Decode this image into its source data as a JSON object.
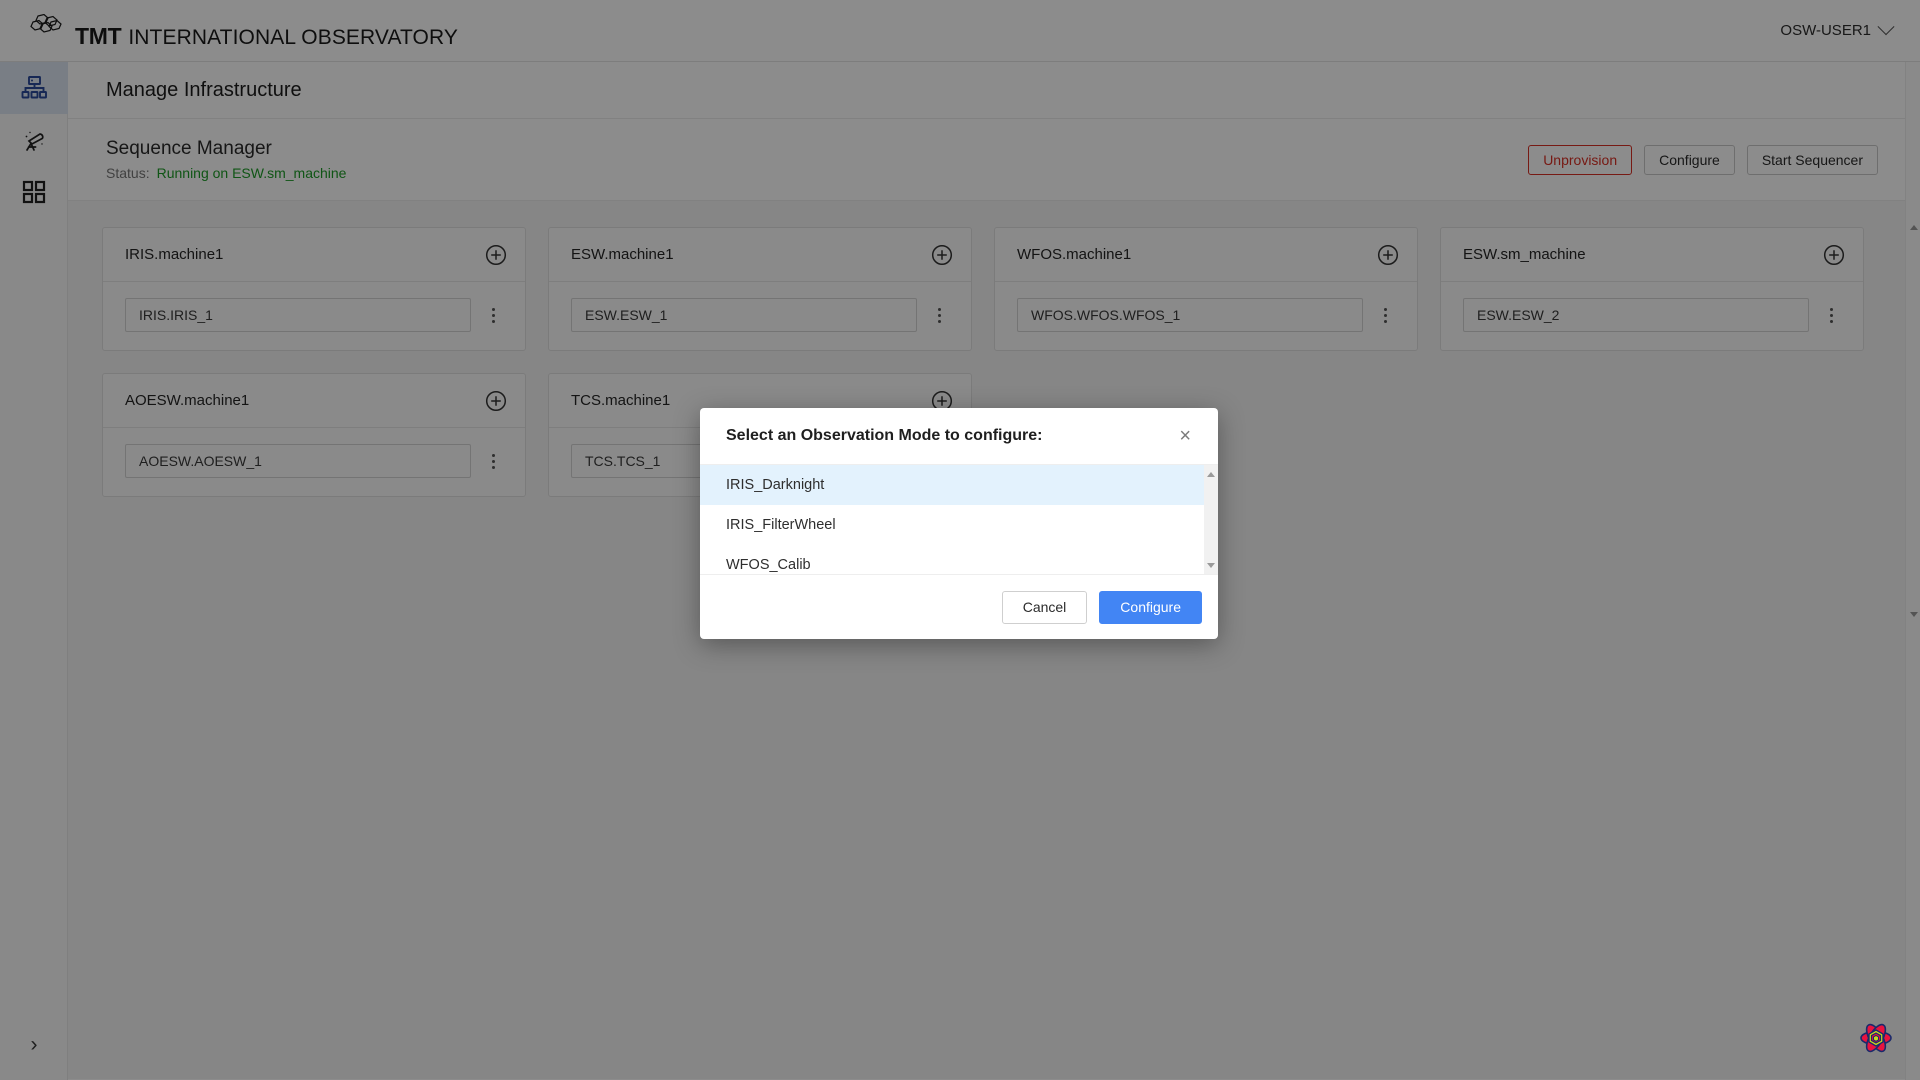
{
  "topbar": {
    "brand_tmt": "TMT",
    "brand_rest": "INTERNATIONAL OBSERVATORY",
    "user": "OSW-USER1"
  },
  "sidebar": {
    "items": [
      {
        "icon": "sitemap-icon",
        "name": "manage-infrastructure",
        "active": true
      },
      {
        "icon": "telescope-icon",
        "name": "observations",
        "active": false
      },
      {
        "icon": "grid-icon",
        "name": "resources",
        "active": false
      }
    ],
    "expand_label": "›"
  },
  "header": {
    "title": "Manage Infrastructure"
  },
  "sequence_manager": {
    "title": "Sequence Manager",
    "status_label": "Status:",
    "status_value": "Running on ESW.sm_machine",
    "status_color": "#1d9b27",
    "buttons": [
      {
        "label": "Unprovision",
        "style": "danger"
      },
      {
        "label": "Configure",
        "style": "default"
      },
      {
        "label": "Start Sequencer",
        "style": "default"
      }
    ]
  },
  "machines": [
    {
      "title": "IRIS.machine1",
      "sequencers": [
        "IRIS.IRIS_1"
      ]
    },
    {
      "title": "ESW.machine1",
      "sequencers": [
        "ESW.ESW_1"
      ]
    },
    {
      "title": "WFOS.machine1",
      "sequencers": [
        "WFOS.WFOS.WFOS_1"
      ]
    },
    {
      "title": "ESW.sm_machine",
      "sequencers": [
        "ESW.ESW_2"
      ]
    },
    {
      "title": "AOESW.machine1",
      "sequencers": [
        "AOESW.AOESW_1"
      ]
    },
    {
      "title": "TCS.machine1",
      "sequencers": [
        "TCS.TCS_1"
      ]
    }
  ],
  "modal": {
    "title": "Select an Observation Mode to configure:",
    "close_label": "×",
    "options": [
      {
        "label": "IRIS_Darknight",
        "selected": true
      },
      {
        "label": "IRIS_FilterWheel",
        "selected": false
      },
      {
        "label": "WFOS_Calib",
        "selected": false
      }
    ],
    "cancel_label": "Cancel",
    "confirm_label": "Configure",
    "confirm_color": "#4285f4",
    "selected_bg": "#e3f2fd"
  }
}
